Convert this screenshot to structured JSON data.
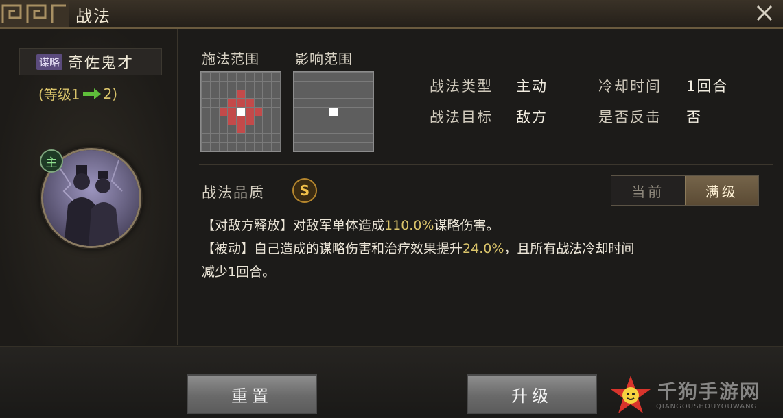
{
  "window": {
    "title": "战法",
    "close_icon": "close-icon"
  },
  "left": {
    "type_badge": "谋略",
    "skill_name": "奇佐鬼才",
    "level_open": "(等级1",
    "level_close": "2)",
    "main_badge": "主"
  },
  "ranges": {
    "cast_label": "施法范围",
    "effect_label": "影响范围"
  },
  "info": {
    "type_label": "战法类型",
    "type_value": "主动",
    "cooldown_label": "冷却时间",
    "cooldown_value": "1回合",
    "target_label": "战法目标",
    "target_value": "敌方",
    "counter_label": "是否反击",
    "counter_value": "否"
  },
  "quality": {
    "label": "战法品质",
    "grade": "S"
  },
  "toggle": {
    "current": "当前",
    "max": "满级",
    "selected": "满级"
  },
  "description": {
    "line1_prefix": "【对敌方释放】对敌军单体造成",
    "line1_value": "110.0%",
    "line1_suffix": "谋略伤害。",
    "line2_prefix": "【被动】自己造成的谋略伤害和治疗效果提升",
    "line2_value": "24.0%",
    "line2_suffix": "，且所有战法冷却时间",
    "line3": "减少1回合。"
  },
  "buttons": {
    "reset": "重置",
    "upgrade": "升级"
  },
  "watermark": {
    "text": "千狗手游网",
    "sub": "QIANGOUSHOUYOUWANG"
  },
  "colors": {
    "highlight": "#d9c36a",
    "cast_cell": "#c34a4a",
    "center_cell": "#ffffff",
    "quality": "#f2c14a"
  }
}
